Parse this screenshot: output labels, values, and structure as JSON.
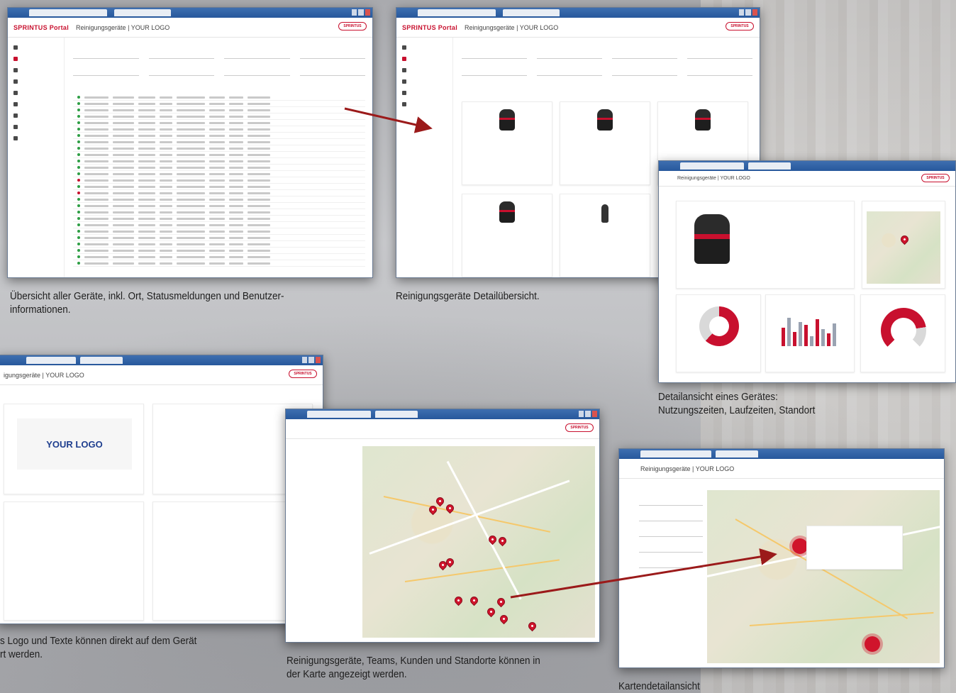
{
  "captions": {
    "overview": "Übersicht aller Geräte, inkl. Ort, Statusmeldungen und Benutzer-\ninformationen.",
    "detail_overview": "Reinigungsgeräte Detailübersicht.",
    "device_detail": "Detailansicht eines Gerätes:\nNutzungszeiten, Laufzeiten, Standort",
    "logo_text": "s Logo und  Texte können direkt auf dem Gerät\nrt werden.",
    "map": "Reinigungsgeräte, Teams, Kunden und Standorte können in\nder Karte angezeigt werden.",
    "map_detail": "Kartendetailansicht"
  },
  "app": {
    "brand": "SPRINTUS Portal",
    "page_title": "Reinigungsgeräte | YOUR LOGO",
    "page_title_short": "igungsgeräte | YOUR LOGO",
    "logo_badge": "SPRINTUS",
    "your_logo": "YOUR LOGO"
  },
  "colors": {
    "brand_red": "#c8102e",
    "window_blue": "#2f63a8",
    "arrow": "#9b1a1a"
  }
}
